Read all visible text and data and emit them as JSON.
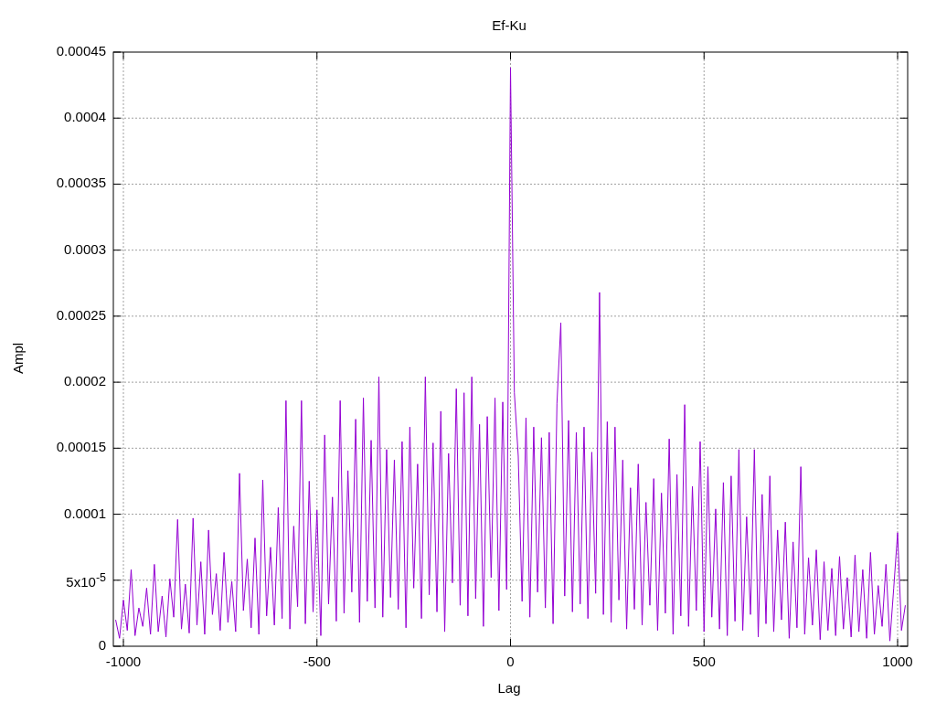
{
  "chart": {
    "chart_data": {
      "type": "line",
      "title": "Ef-Ku",
      "xlabel": "Lag",
      "ylabel": "Ampl",
      "xlim": [
        -1026,
        1026
      ],
      "ylim": [
        0,
        0.00045
      ],
      "grid": true,
      "xticks": [
        -1000,
        -500,
        0,
        500,
        1000
      ],
      "yticks": [
        {
          "value": 0,
          "label": "0"
        },
        {
          "value": 5e-05,
          "label": "5x10$^{-5}$"
        },
        {
          "value": 0.0001,
          "label": "0.0001"
        },
        {
          "value": 0.00015,
          "label": "0.00015"
        },
        {
          "value": 0.0002,
          "label": "0.0002"
        },
        {
          "value": 0.00025,
          "label": "0.00025"
        },
        {
          "value": 0.0003,
          "label": "0.0003"
        },
        {
          "value": 0.00035,
          "label": "0.00035"
        },
        {
          "value": 0.0004,
          "label": "0.0004"
        },
        {
          "value": 0.00045,
          "label": "0.00045"
        }
      ],
      "x": [
        -1020,
        -1010,
        -1000,
        -990,
        -980,
        -970,
        -960,
        -950,
        -940,
        -930,
        -920,
        -910,
        -900,
        -890,
        -880,
        -870,
        -860,
        -850,
        -840,
        -830,
        -820,
        -810,
        -800,
        -790,
        -780,
        -770,
        -760,
        -750,
        -740,
        -730,
        -720,
        -710,
        -700,
        -690,
        -680,
        -670,
        -660,
        -650,
        -640,
        -630,
        -620,
        -610,
        -600,
        -590,
        -580,
        -570,
        -560,
        -550,
        -540,
        -530,
        -520,
        -510,
        -500,
        -490,
        -480,
        -470,
        -460,
        -450,
        -440,
        -430,
        -420,
        -410,
        -400,
        -390,
        -380,
        -370,
        -360,
        -350,
        -340,
        -330,
        -320,
        -310,
        -300,
        -290,
        -280,
        -270,
        -260,
        -250,
        -240,
        -230,
        -220,
        -210,
        -200,
        -190,
        -180,
        -170,
        -160,
        -150,
        -140,
        -130,
        -120,
        -110,
        -100,
        -90,
        -80,
        -70,
        -60,
        -50,
        -40,
        -30,
        -20,
        -10,
        0,
        10,
        20,
        30,
        40,
        50,
        60,
        70,
        80,
        90,
        100,
        110,
        120,
        130,
        140,
        150,
        160,
        170,
        180,
        190,
        200,
        210,
        220,
        230,
        240,
        250,
        260,
        270,
        280,
        290,
        300,
        310,
        320,
        330,
        340,
        350,
        360,
        370,
        380,
        390,
        400,
        410,
        420,
        430,
        440,
        450,
        460,
        470,
        480,
        490,
        500,
        510,
        520,
        530,
        540,
        550,
        560,
        570,
        580,
        590,
        600,
        610,
        620,
        630,
        640,
        650,
        660,
        670,
        680,
        690,
        700,
        710,
        720,
        730,
        740,
        750,
        760,
        770,
        780,
        790,
        800,
        810,
        820,
        830,
        840,
        850,
        860,
        870,
        880,
        890,
        900,
        910,
        920,
        930,
        940,
        950,
        960,
        970,
        980,
        990,
        1000,
        1010,
        1020
      ],
      "series": [
        {
          "color": "#9400d3",
          "values": [
            2e-05,
            6e-06,
            3.5e-05,
            1.2e-05,
            5.8e-05,
            8e-06,
            2.9e-05,
            1.5e-05,
            4.4e-05,
            9e-06,
            6.2e-05,
            1.1e-05,
            3.8e-05,
            7e-06,
            5.1e-05,
            2.2e-05,
            9.6e-05,
            1.3e-05,
            4.7e-05,
            1e-05,
            9.7e-05,
            1.6e-05,
            6.4e-05,
            9e-06,
            8.8e-05,
            2.4e-05,
            5.5e-05,
            1.2e-05,
            7.1e-05,
            1.8e-05,
            4.9e-05,
            1.1e-05,
            0.000131,
            2.7e-05,
            6.6e-05,
            1.4e-05,
            8.2e-05,
            9e-06,
            0.000126,
            2.3e-05,
            7.5e-05,
            1.6e-05,
            0.000105,
            2.1e-05,
            0.000186,
            1.3e-05,
            9.1e-05,
            3e-05,
            0.000186,
            1.7e-05,
            0.000125,
            2.6e-05,
            0.000103,
            8e-06,
            0.00016,
            3.2e-05,
            0.000113,
            1.9e-05,
            0.000186,
            2.5e-05,
            0.000133,
            4.1e-05,
            0.000172,
            1.8e-05,
            0.000188,
            3.4e-05,
            0.000156,
            2.9e-05,
            0.000204,
            2.2e-05,
            0.000149,
            3.7e-05,
            0.000141,
            2.8e-05,
            0.000155,
            1.4e-05,
            0.000166,
            4.4e-05,
            0.000138,
            2.1e-05,
            0.000204,
            3.9e-05,
            0.000154,
            2.6e-05,
            0.000178,
            1.1e-05,
            0.000146,
            4.8e-05,
            0.000195,
            3.1e-05,
            0.000192,
            2.3e-05,
            0.000204,
            3.6e-05,
            0.000168,
            1.5e-05,
            0.000174,
            5.2e-05,
            0.000188,
            2.7e-05,
            0.000185,
            4.3e-05,
            0.000438,
            0.000192,
            0.000144,
            3.4e-05,
            0.000173,
            2.2e-05,
            0.000166,
            4.1e-05,
            0.000158,
            2.9e-05,
            0.000162,
            1.7e-05,
            0.000184,
            0.000245,
            3.8e-05,
            0.000171,
            2.6e-05,
            0.000162,
            3.2e-05,
            0.000166,
            2.1e-05,
            0.000147,
            4e-05,
            0.000268,
            2.4e-05,
            0.00017,
            1.8e-05,
            0.000166,
            3.5e-05,
            0.000141,
            1.3e-05,
            0.00012,
            2.8e-05,
            0.000138,
            1.6e-05,
            0.000109,
            3.1e-05,
            0.000127,
            1.2e-05,
            0.000116,
            2.5e-05,
            0.000157,
            9e-06,
            0.00013,
            2.3e-05,
            0.000183,
            1.5e-05,
            0.000121,
            2.7e-05,
            0.000155,
            1.1e-05,
            0.000136,
            2.2e-05,
            0.000104,
            1.3e-05,
            0.000124,
            8e-06,
            0.000129,
            1.9e-05,
            0.000149,
            1.2e-05,
            9.8e-05,
            2.4e-05,
            0.000149,
            7e-06,
            0.000115,
            1.7e-05,
            0.000129,
            1.1e-05,
            8.8e-05,
            2e-05,
            9.4e-05,
            6e-06,
            7.9e-05,
            1.4e-05,
            0.000136,
            9e-06,
            6.7e-05,
            1.6e-05,
            7.3e-05,
            5e-06,
            6.4e-05,
            1.2e-05,
            5.9e-05,
            8e-06,
            6.8e-05,
            1.3e-05,
            5.2e-05,
            7e-06,
            6.9e-05,
            1.1e-05,
            5.8e-05,
            6e-06,
            7.1e-05,
            9e-06,
            4.6e-05,
            1.5e-05,
            6.2e-05,
            4e-06,
            4.4e-05,
            8.6e-05,
            1.2e-05,
            3.1e-05
          ]
        }
      ]
    }
  }
}
